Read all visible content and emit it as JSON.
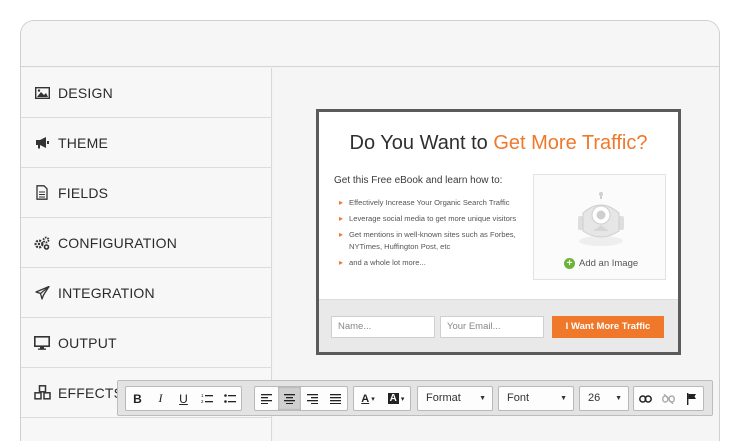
{
  "sidebar": {
    "items": [
      {
        "label": "DESIGN",
        "icon": "image-icon"
      },
      {
        "label": "THEME",
        "icon": "megaphone-icon"
      },
      {
        "label": "FIELDS",
        "icon": "document-icon"
      },
      {
        "label": "CONFIGURATION",
        "icon": "gears-icon"
      },
      {
        "label": "INTEGRATION",
        "icon": "paper-plane-icon"
      },
      {
        "label": "OUTPUT",
        "icon": "monitor-icon"
      },
      {
        "label": "EFFECTS",
        "icon": "cubes-icon"
      }
    ]
  },
  "optin": {
    "headline_prefix": "Do You Want to ",
    "headline_accent": "Get More Traffic?",
    "intro": "Get this Free eBook and learn how to:",
    "bullets": [
      "Effectively Increase Your Organic Search Traffic",
      "Leverage social media to get more unique visitors",
      "Get mentions in well-known sites such as Forbes, NYTimes, Huffington Post, etc",
      "and a whole lot more..."
    ],
    "image_label": "Add an Image",
    "name_placeholder": "Name...",
    "email_placeholder": "Your Email...",
    "cta_label": "I Want More Traffic",
    "accent_color": "#f0782a"
  },
  "toolbar": {
    "bold": "B",
    "italic": "I",
    "underline": "U",
    "format_label": "Format",
    "font_label": "Font",
    "size_label": "26",
    "text_color_label": "A",
    "bg_color_label": "A"
  }
}
